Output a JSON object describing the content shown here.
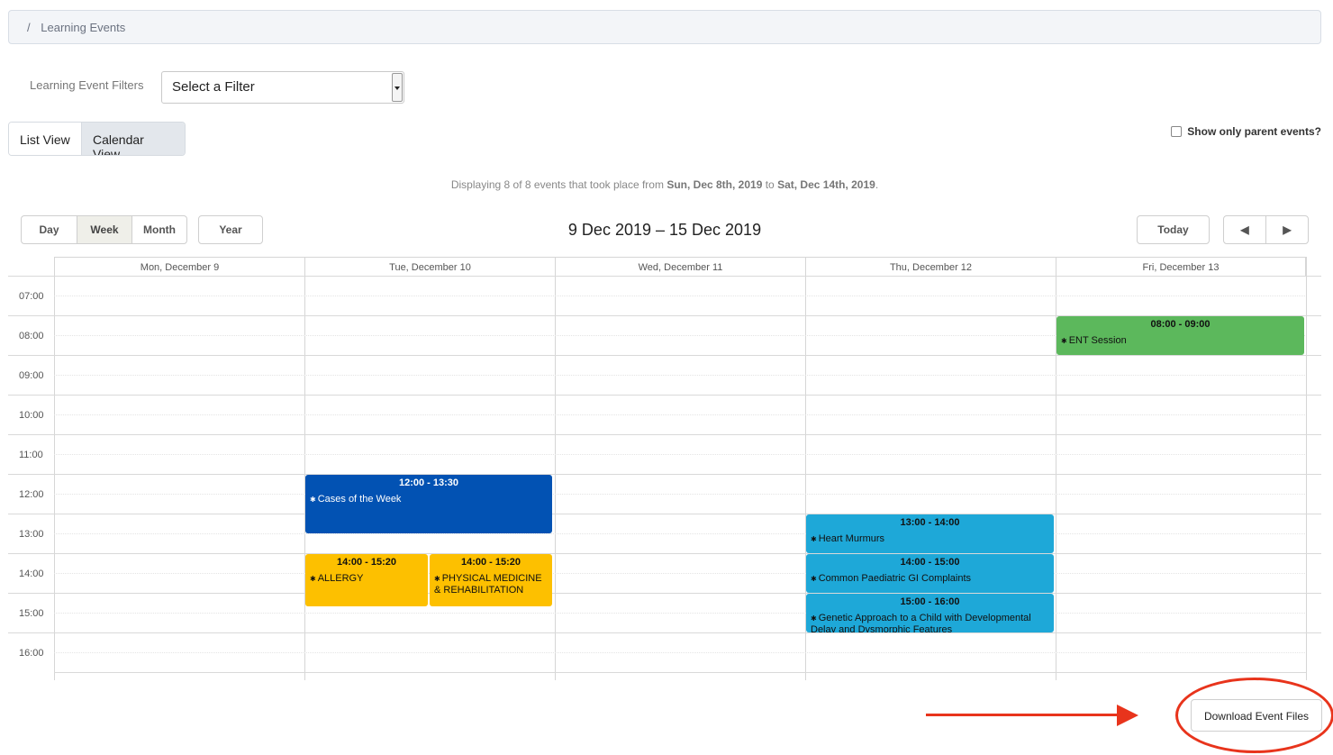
{
  "breadcrumb": {
    "separator": "/",
    "current": "Learning Events"
  },
  "filter": {
    "label": "Learning Event Filters",
    "selected": "Select a Filter"
  },
  "views": {
    "list": "List View",
    "calendar": "Calendar View",
    "active": "calendar"
  },
  "parent_only": {
    "label": "Show only parent events?",
    "checked": false
  },
  "displaying": {
    "prefix": "Displaying 8 of 8 events that took place from",
    "start": "Sun, Dec 8th, 2019",
    "to": "to",
    "end": "Sat, Dec 14th, 2019",
    "suffix": "."
  },
  "calendar": {
    "range_buttons": [
      "Day",
      "Week",
      "Month"
    ],
    "active_range": "Week",
    "year_button": "Year",
    "title": "9 Dec 2019 – 15 Dec 2019",
    "today_button": "Today",
    "days": [
      "Mon, December 9",
      "Tue, December 10",
      "Wed, December 11",
      "Thu, December 12",
      "Fri, December 13"
    ],
    "times": [
      "07:00",
      "08:00",
      "09:00",
      "10:00",
      "11:00",
      "12:00",
      "13:00",
      "14:00",
      "15:00",
      "16:00"
    ],
    "events": [
      {
        "time": "08:00 - 09:00",
        "title": "ENT Session",
        "color": "#5cb85c",
        "text_color": "#111111"
      },
      {
        "time": "12:00 - 13:30",
        "title": "Cases of the Week",
        "color": "#0252b3",
        "text_color": "#ffffff"
      },
      {
        "time": "14:00 - 15:20",
        "title": "ALLERGY",
        "color": "#fdc000",
        "text_color": "#111111"
      },
      {
        "time": "14:00 - 15:20",
        "title": "PHYSICAL MEDICINE & REHABILITATION",
        "color": "#fdc000",
        "text_color": "#111111"
      },
      {
        "time": "13:00 - 14:00",
        "title": "Heart Murmurs",
        "color": "#1ea8d8",
        "text_color": "#111111"
      },
      {
        "time": "14:00 - 15:00",
        "title": "Common Paediatric GI Complaints",
        "color": "#1ea8d8",
        "text_color": "#111111"
      },
      {
        "time": "15:00 - 16:00",
        "title": "Genetic Approach to a Child with Developmental Delay and Dysmorphic Features",
        "color": "#1ea8d8",
        "text_color": "#111111"
      }
    ]
  },
  "download": {
    "label": "Download Event Files"
  },
  "annotation_color": "#e8341c"
}
